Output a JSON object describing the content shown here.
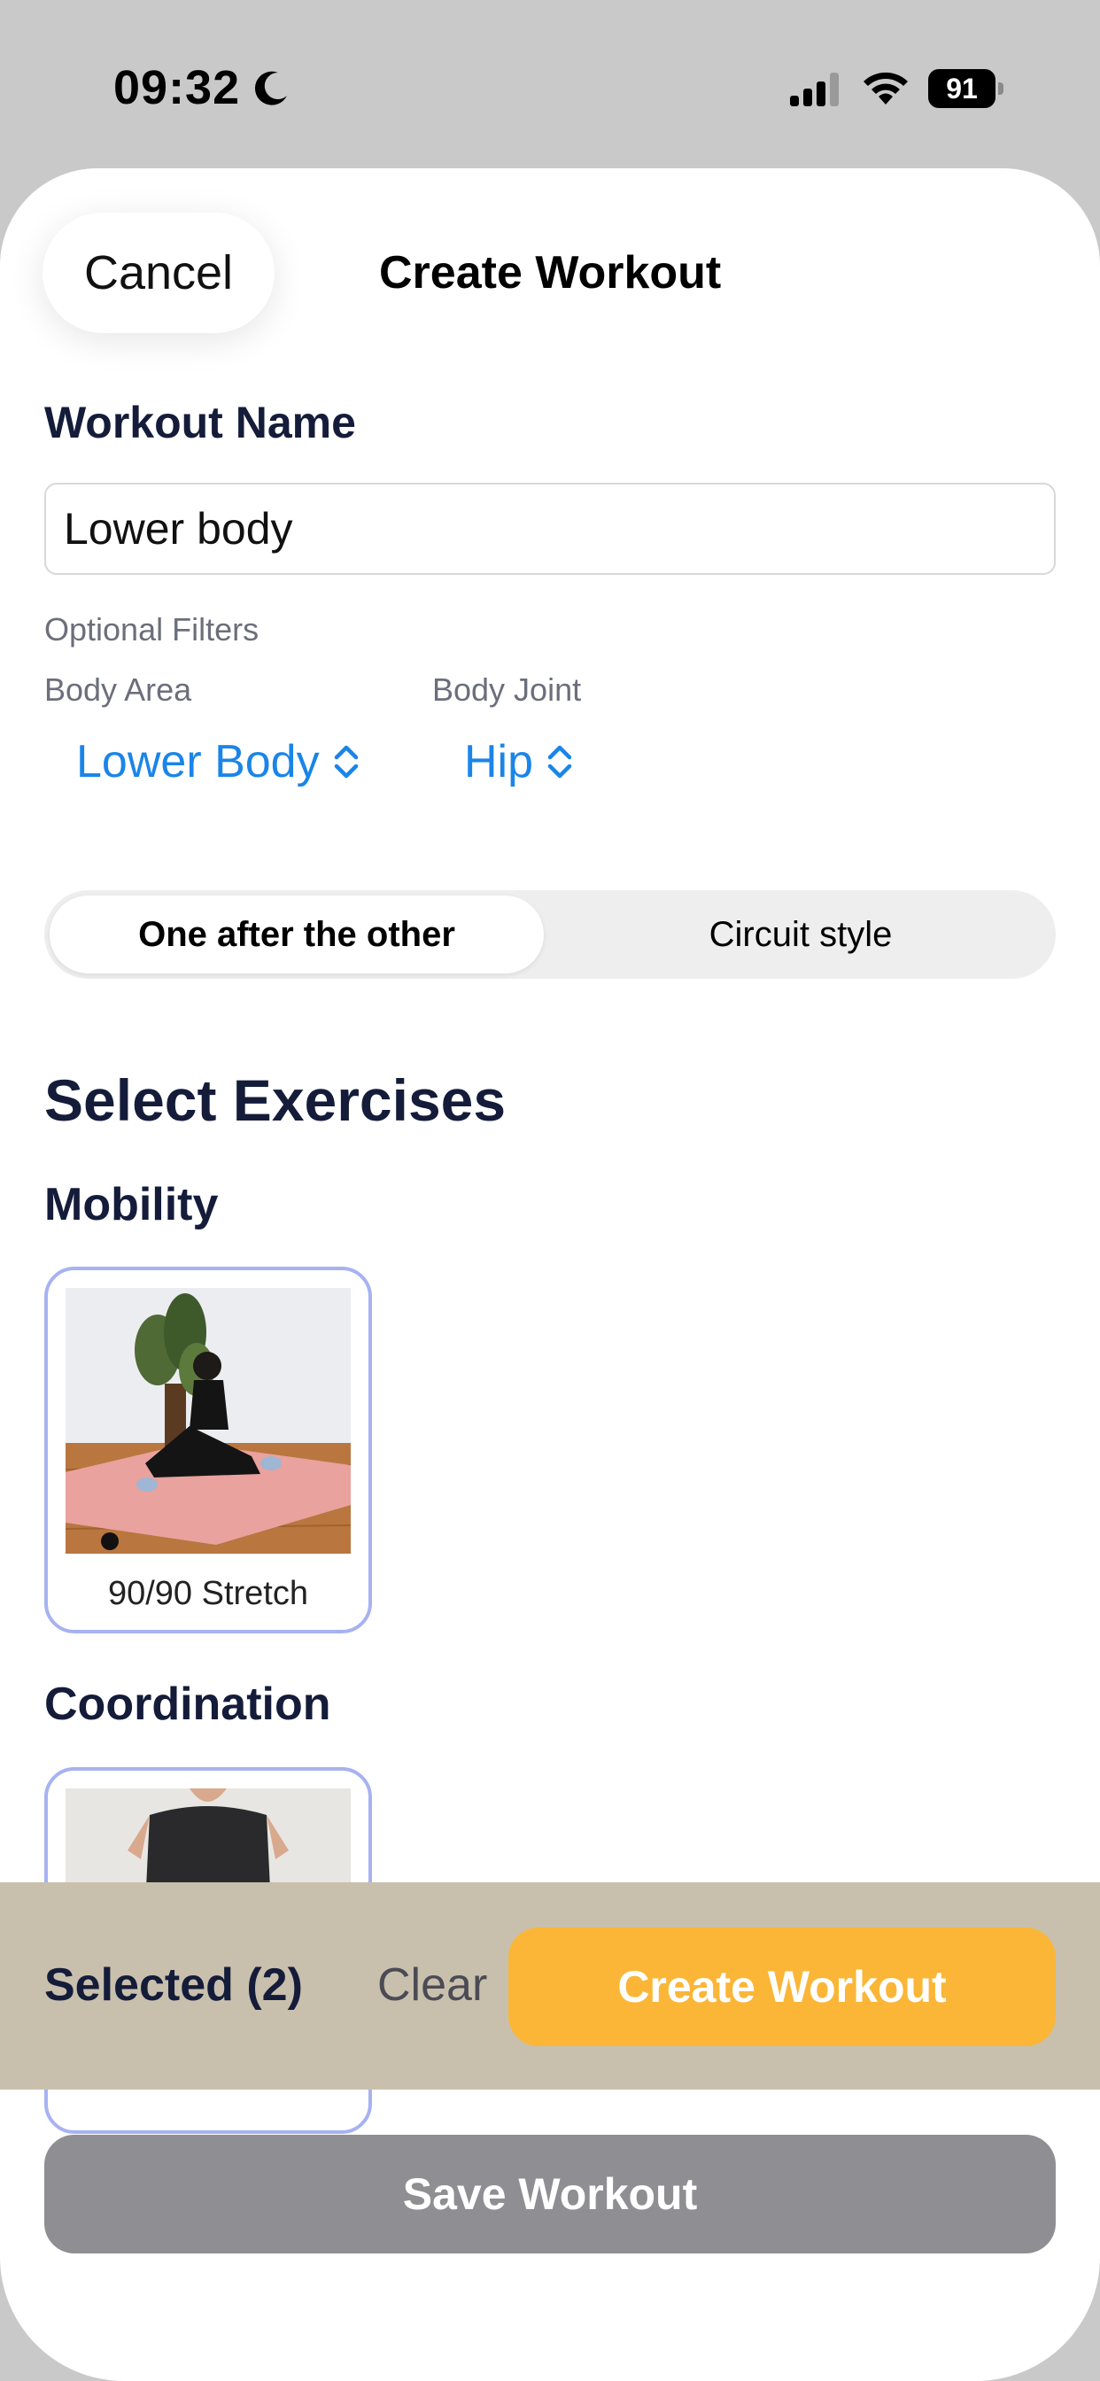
{
  "status_bar": {
    "time": "09:32",
    "battery": "91",
    "icons": [
      "moon-icon",
      "signal-icon",
      "wifi-icon",
      "battery-icon"
    ]
  },
  "header": {
    "cancel_label": "Cancel",
    "title": "Create Workout"
  },
  "form": {
    "name_label": "Workout Name",
    "name_value": "Lower body",
    "optional_filters_label": "Optional Filters",
    "body_area_label": "Body Area",
    "body_area_value": "Lower Body",
    "body_joint_label": "Body Joint",
    "body_joint_value": "Hip"
  },
  "mode": {
    "options": [
      "One after the other",
      "Circuit style"
    ],
    "selected": "One after the other"
  },
  "exercises": {
    "title": "Select Exercises",
    "categories": [
      {
        "name": "Mobility",
        "items": [
          {
            "label": "90/90 Stretch"
          }
        ]
      },
      {
        "name": "Coordination",
        "items": [
          {
            "label": ""
          }
        ]
      }
    ]
  },
  "action_bar": {
    "selected_label": "Selected (2)",
    "clear_label": "Clear",
    "create_label": "Create Workout"
  },
  "footer": {
    "save_label": "Save Workout"
  },
  "colors": {
    "accent_blue": "#1a85e8",
    "create_orange": "#fbb637",
    "action_bar_bg": "#c8c0ad",
    "card_border": "#a7b2f2",
    "save_gray": "#8e8e93",
    "navy_text": "#141c3a"
  }
}
